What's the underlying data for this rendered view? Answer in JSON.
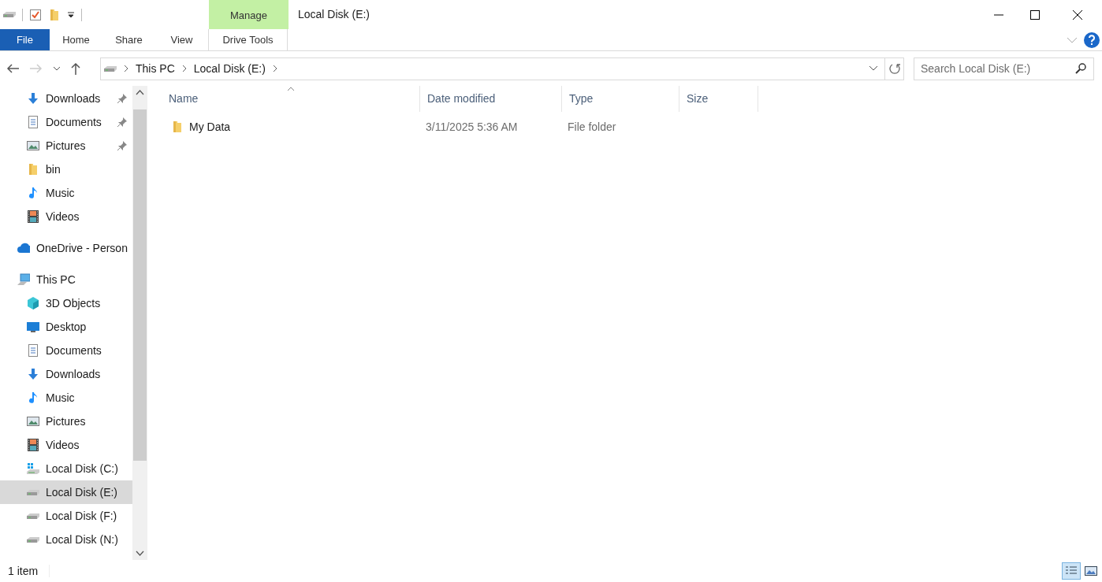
{
  "window": {
    "title": "Local Disk (E:)"
  },
  "ribbon": {
    "context_tab": {
      "label": "Manage"
    },
    "tabs": [
      {
        "label": "File",
        "kind": "file",
        "selected": false
      },
      {
        "label": "Home",
        "kind": "tab",
        "selected": false
      },
      {
        "label": "Share",
        "kind": "tab",
        "selected": false
      },
      {
        "label": "View",
        "kind": "tab",
        "selected": false
      },
      {
        "label": "Drive Tools",
        "kind": "context",
        "selected": false
      }
    ]
  },
  "address_bar": {
    "crumbs": [
      "This PC",
      "Local Disk (E:)"
    ]
  },
  "search": {
    "placeholder": "Search Local Disk (E:)"
  },
  "sidebar": {
    "quick_access_items": [
      {
        "label": "Downloads",
        "kind": "download",
        "pinned": true,
        "selected": false
      },
      {
        "label": "Documents",
        "kind": "document",
        "pinned": true,
        "selected": false
      },
      {
        "label": "Pictures",
        "kind": "picture",
        "pinned": true,
        "selected": false
      },
      {
        "label": "bin",
        "kind": "folder",
        "pinned": false,
        "selected": false
      },
      {
        "label": "Music",
        "kind": "music",
        "pinned": false,
        "selected": false
      },
      {
        "label": "Videos",
        "kind": "video",
        "pinned": false,
        "selected": false
      }
    ],
    "items": [
      {
        "label": "OneDrive - Person",
        "kind": "cloud",
        "selected": false
      },
      {
        "label": "This PC",
        "kind": "pc",
        "selected": false,
        "children": [
          {
            "label": "3D Objects",
            "kind": "cube",
            "selected": false
          },
          {
            "label": "Desktop",
            "kind": "desktop",
            "selected": false
          },
          {
            "label": "Documents",
            "kind": "document",
            "selected": false
          },
          {
            "label": "Downloads",
            "kind": "download",
            "selected": false
          },
          {
            "label": "Music",
            "kind": "music",
            "selected": false
          },
          {
            "label": "Pictures",
            "kind": "picture",
            "selected": false
          },
          {
            "label": "Videos",
            "kind": "video",
            "selected": false
          },
          {
            "label": "Local Disk (C:)",
            "kind": "windrive",
            "selected": false
          },
          {
            "label": "Local Disk (E:)",
            "kind": "drive",
            "selected": true
          },
          {
            "label": "Local Disk (F:)",
            "kind": "drive",
            "selected": false
          },
          {
            "label": "Local Disk (N:)",
            "kind": "drive",
            "selected": false
          }
        ]
      }
    ]
  },
  "table": {
    "columns": [
      "Name",
      "Date modified",
      "Type",
      "Size"
    ],
    "rows": [
      {
        "name": "My Data",
        "date_modified": "3/11/2025 5:36 AM",
        "type": "File folder"
      }
    ]
  },
  "status_bar": {
    "text": "1 item"
  }
}
